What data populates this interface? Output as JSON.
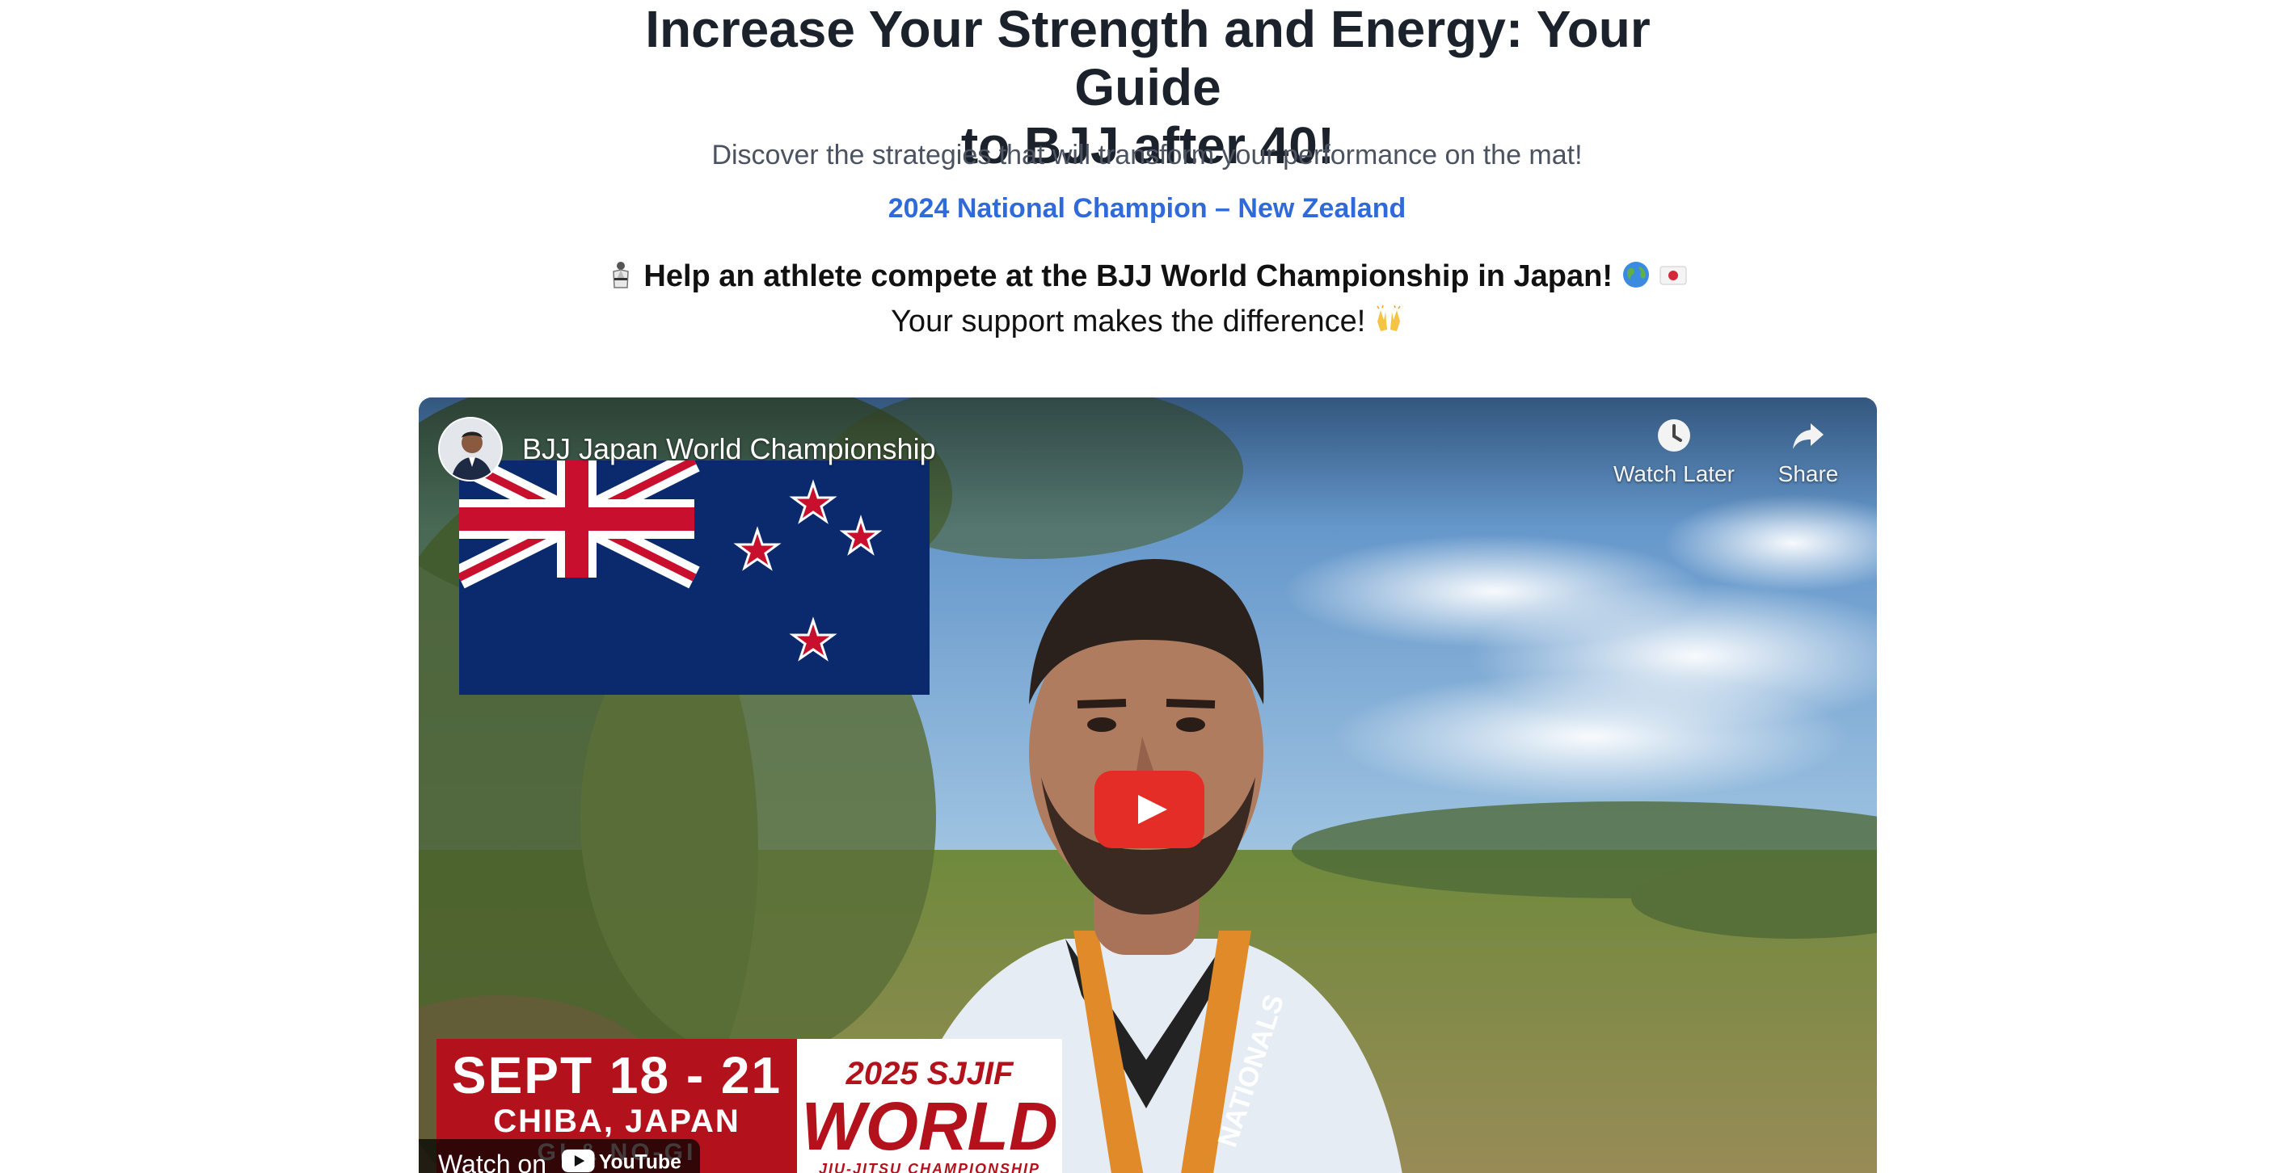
{
  "page": {
    "title_line1": "Increase Your Strength and Energy: Your Guide",
    "title_line2": "to BJJ after 40!",
    "subtitle": "Discover the strategies that will transform your performance on the mat!",
    "champion": "2024 National Champion – New Zealand",
    "help_text": "Help an athlete compete at the BJJ World Championship in Japan!",
    "support_text": "Your support makes the difference!"
  },
  "video": {
    "title": "BJJ Japan World Championship",
    "watch_later": "Watch Later",
    "share": "Share",
    "watch_on": "Watch on",
    "youtube": "YouTube",
    "event": {
      "dates": "SEPT 18 - 21",
      "place": "CHIBA, JAPAN",
      "mode": "GI & NO-GI",
      "year_org": "2025 SJJIF",
      "world": "WORLD",
      "sub": "JIU-JITSU CHAMPIONSHIP"
    },
    "medal_text": "NATIONALS"
  },
  "colors": {
    "accent_link": "#2f6ad8",
    "play_red": "#e52d27",
    "event_red": "#b3121c"
  },
  "icons": [
    "gi-emoji-icon",
    "globe-emoji-icon",
    "japan-flag-emoji-icon",
    "raised-hands-emoji-icon",
    "clock-icon",
    "share-arrow-icon",
    "play-icon",
    "youtube-logo-icon"
  ]
}
